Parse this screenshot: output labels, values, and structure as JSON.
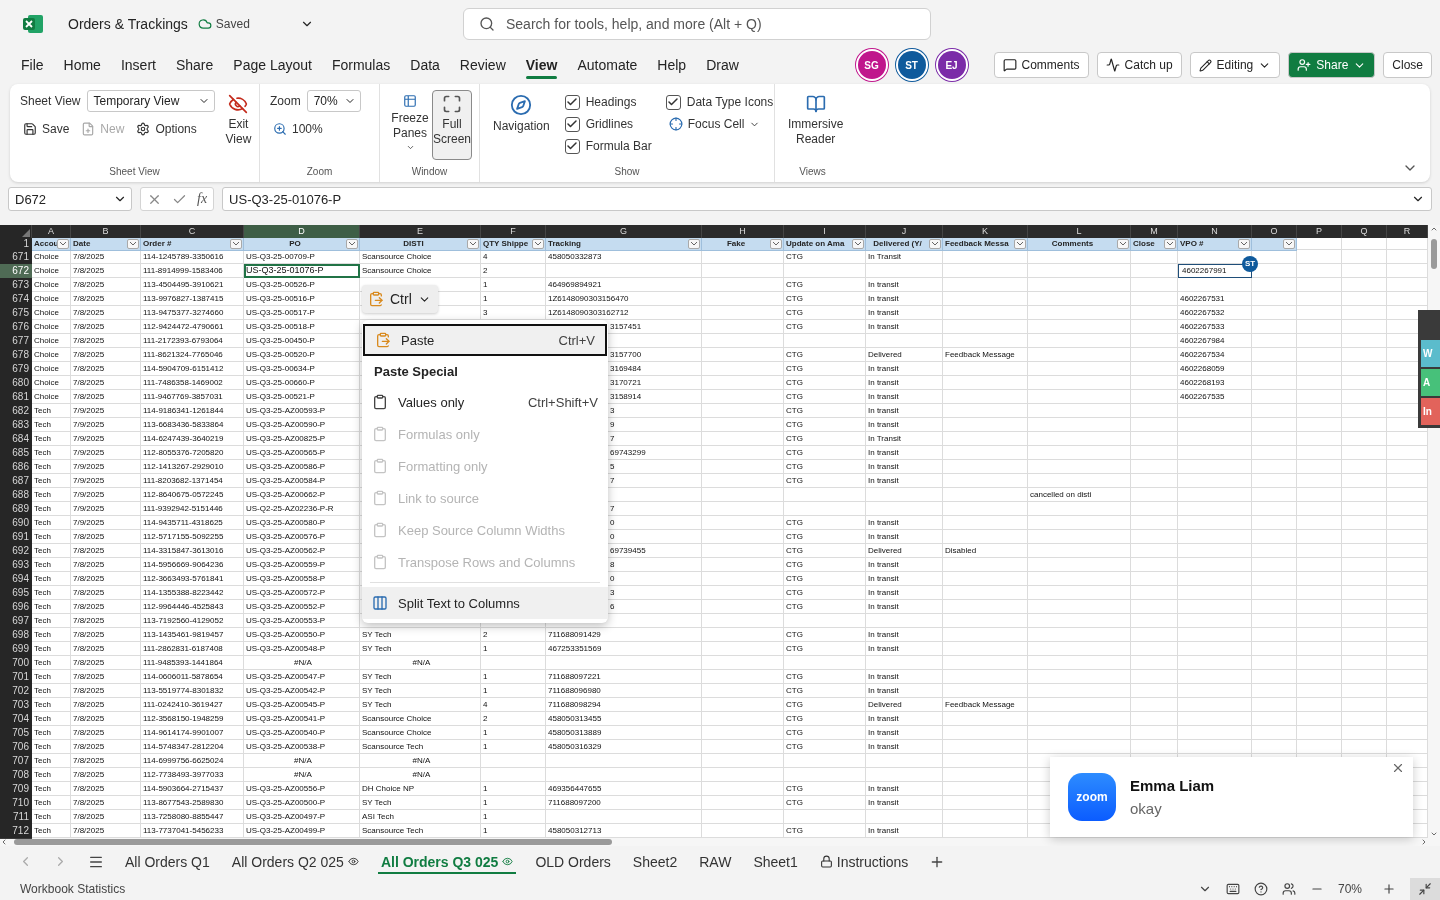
{
  "title_bar": {
    "document_title": "Orders & Trackings",
    "save_status": "Saved",
    "search_placeholder": "Search for tools, help, and more (Alt + Q)"
  },
  "menu_tabs": [
    {
      "label": "File",
      "selected": false
    },
    {
      "label": "Home",
      "selected": false
    },
    {
      "label": "Insert",
      "selected": false
    },
    {
      "label": "Share",
      "selected": false
    },
    {
      "label": "Page Layout",
      "selected": false
    },
    {
      "label": "Formulas",
      "selected": false
    },
    {
      "label": "Data",
      "selected": false
    },
    {
      "label": "Review",
      "selected": false
    },
    {
      "label": "View",
      "selected": true
    },
    {
      "label": "Automate",
      "selected": false
    },
    {
      "label": "Help",
      "selected": false
    },
    {
      "label": "Draw",
      "selected": false
    }
  ],
  "collaborators": [
    {
      "initials": "SG",
      "color": "#c0168c"
    },
    {
      "initials": "ST",
      "color": "#0f5a9c"
    },
    {
      "initials": "EJ",
      "color": "#7b2ba8"
    }
  ],
  "actions": [
    {
      "label": "Comments",
      "kind": "comments"
    },
    {
      "label": "Catch up",
      "kind": "catchup"
    },
    {
      "label": "Editing",
      "kind": "editing"
    },
    {
      "label": "Share",
      "kind": "share"
    },
    {
      "label": "Close",
      "kind": "close"
    }
  ],
  "ribbon": {
    "sheet_view": {
      "label": "Sheet View",
      "view": "Temporary View",
      "exit": "Exit View",
      "save": "Save",
      "new": {
        "label": "New",
        "disabled": true
      },
      "options": "Options",
      "group": "Sheet View"
    },
    "zoom": {
      "label": "Zoom",
      "value": "70%",
      "reset": "100%",
      "group": "Zoom"
    },
    "window": {
      "freeze": "Freeze Panes",
      "full_screen": {
        "label": "Full Screen",
        "selected": true
      },
      "group": "Window"
    },
    "show": {
      "navigation": "Navigation",
      "options": [
        {
          "label": "Headings",
          "checked": true
        },
        {
          "label": "Gridlines",
          "checked": true
        },
        {
          "label": "Formula Bar",
          "checked": true
        },
        {
          "label": "Data Type Icons",
          "checked": true
        }
      ],
      "focus_cell": "Focus Cell",
      "group": "Show"
    },
    "views": {
      "immersive": "Immersive Reader",
      "group": "Views"
    }
  },
  "formula_bar": {
    "name_box": "D672",
    "function_label": "fx",
    "formula": "US-Q3-25-01076-P"
  },
  "sheet": {
    "header_row_number": "1",
    "columns": [
      {
        "letter": "A",
        "header": "Accou",
        "filter": true,
        "selected": false
      },
      {
        "letter": "B",
        "header": "Date",
        "filter": true,
        "selected": false
      },
      {
        "letter": "C",
        "header": "Order #",
        "filter": true,
        "selected": false
      },
      {
        "letter": "D",
        "header": "PO",
        "filter": true,
        "selected": true
      },
      {
        "letter": "E",
        "header": "DISTI",
        "filter": true,
        "selected": false
      },
      {
        "letter": "F",
        "header": "QTY Shippe",
        "filter": true,
        "selected": false
      },
      {
        "letter": "G",
        "header": "Tracking",
        "filter": true,
        "selected": false
      },
      {
        "letter": "H",
        "header": "Fake",
        "filter": true,
        "selected": false
      },
      {
        "letter": "I",
        "header": "Update on Ama",
        "filter": true,
        "selected": false
      },
      {
        "letter": "J",
        "header": "Delivered (Y/",
        "filter": true,
        "selected": false
      },
      {
        "letter": "K",
        "header": "Feedback Messa",
        "filter": true,
        "selected": false
      },
      {
        "letter": "L",
        "header": "Comments",
        "filter": true,
        "selected": false
      },
      {
        "letter": "M",
        "header": "Close",
        "filter": true,
        "selected": false
      },
      {
        "letter": "N",
        "header": "VPO #",
        "filter": true,
        "selected": false
      },
      {
        "letter": "O",
        "filter": true,
        "selected": false
      },
      {
        "letter": "P",
        "filter": false,
        "selected": false
      },
      {
        "letter": "Q",
        "filter": false,
        "selected": false
      },
      {
        "letter": "R",
        "filter": false,
        "selected": false
      }
    ],
    "rows": [
      {
        "n": "671",
        "selected": false,
        "cells": {
          "A": "Choice",
          "B": "7/8/2025",
          "C": "114-1245789-3350616",
          "D": "US-Q3-25-00709-P",
          "E": "Scansource Choice",
          "F": "4",
          "G": "458050332873",
          "I": "CTG",
          "J": "In Transit"
        }
      },
      {
        "n": "672",
        "selected": true,
        "cells": {
          "A": "Choice",
          "B": "7/8/2025",
          "C": "111-8914999-1583406",
          "D": "US-Q3-25-01076-P",
          "E": "Scansource Choice",
          "F": "2",
          "N": {
            "text": "4602267991",
            "presence": "ST"
          }
        }
      },
      {
        "n": "673",
        "selected": false,
        "cells": {
          "A": "Choice",
          "B": "7/8/2025",
          "C": "113-4504495-3910621",
          "D": "US-Q3-25-00526-P",
          "F": "1",
          "G": "464969894921",
          "I": "CTG",
          "J": "In transit"
        }
      },
      {
        "n": "674",
        "selected": false,
        "cells": {
          "A": "Choice",
          "B": "7/8/2025",
          "C": "113-9976827-1387415",
          "D": "US-Q3-25-00516-P",
          "F": "1",
          "G": "1Z6148090303156470",
          "I": "CTG",
          "J": "In transit",
          "N": "4602267531"
        }
      },
      {
        "n": "675",
        "selected": false,
        "cells": {
          "A": "Choice",
          "B": "7/8/2025",
          "C": "113-9475377-3274660",
          "D": "US-Q3-25-00517-P",
          "F": "3",
          "G": "1Z6148090303162712",
          "I": "CTG",
          "J": "In transit",
          "N": "4602267532"
        }
      },
      {
        "n": "676",
        "selected": false,
        "cells": {
          "A": "Choice",
          "B": "7/8/2025",
          "C": "112-9424472-4790661",
          "D": "US-Q3-25-00518-P",
          "G": {
            "text": "3157451",
            "kind": "partial"
          },
          "I": "CTG",
          "J": "In transit",
          "N": "4602267533"
        }
      },
      {
        "n": "677",
        "selected": false,
        "cells": {
          "A": "Choice",
          "B": "7/8/2025",
          "C": "111-2172393-6793064",
          "D": "US-Q3-25-00450-P",
          "N": "4602267984"
        }
      },
      {
        "n": "678",
        "selected": false,
        "cells": {
          "A": "Choice",
          "B": "7/8/2025",
          "C": "111-8621324-7765046",
          "D": "US-Q3-25-00520-P",
          "G": {
            "text": "3157700",
            "kind": "partial"
          },
          "I": "CTG",
          "J": "Delivered",
          "K": "Feedback Message",
          "N": "4602267534"
        }
      },
      {
        "n": "679",
        "selected": false,
        "cells": {
          "A": "Choice",
          "B": "7/8/2025",
          "C": "114-5904709-6151412",
          "D": "US-Q3-25-00634-P",
          "G": {
            "text": "3169484",
            "kind": "partial"
          },
          "I": "CTG",
          "J": "In transit",
          "N": "4602268059"
        }
      },
      {
        "n": "680",
        "selected": false,
        "cells": {
          "A": "Choice",
          "B": "7/8/2025",
          "C": "111-7486358-1469002",
          "D": "US-Q3-25-00660-P",
          "G": {
            "text": "3170721",
            "kind": "partial"
          },
          "I": "CTG",
          "J": "In transit",
          "N": "4602268193"
        }
      },
      {
        "n": "681",
        "selected": false,
        "cells": {
          "A": "Choice",
          "B": "7/8/2025",
          "C": "111-9467769-3857031",
          "D": "US-Q3-25-00521-P",
          "G": {
            "text": "3158914",
            "kind": "partial"
          },
          "I": "CTG",
          "J": "In transit",
          "N": "4602267535"
        }
      },
      {
        "n": "682",
        "selected": false,
        "cells": {
          "A": "Tech",
          "B": "7/9/2025",
          "C": "114-9186341-1261844",
          "D": "US-Q3-25-AZ00593-P",
          "G": {
            "text": "3",
            "kind": "partial"
          },
          "I": "CTG",
          "J": "In transit"
        }
      },
      {
        "n": "683",
        "selected": false,
        "cells": {
          "A": "Tech",
          "B": "7/9/2025",
          "C": "113-6683436-5833864",
          "D": "US-Q3-25-AZ00590-P",
          "G": {
            "text": "9",
            "kind": "partial"
          },
          "I": "CTG",
          "J": "In transit"
        }
      },
      {
        "n": "684",
        "selected": false,
        "cells": {
          "A": "Tech",
          "B": "7/9/2025",
          "C": "114-6247439-3640219",
          "D": "US-Q3-25-AZ00825-P",
          "G": {
            "text": "7",
            "kind": "partial"
          },
          "I": "CTG",
          "J": "In Transit"
        }
      },
      {
        "n": "685",
        "selected": false,
        "cells": {
          "A": "Tech",
          "B": "7/9/2025",
          "C": "112-8055376-7205820",
          "D": "US-Q3-25-AZ00565-P",
          "G": {
            "text": "69743299",
            "kind": "partial"
          },
          "I": "CTG",
          "J": "In transit"
        }
      },
      {
        "n": "686",
        "selected": false,
        "cells": {
          "A": "Tech",
          "B": "7/9/2025",
          "C": "112-1413267-2929010",
          "D": "US-Q3-25-AZ00586-P",
          "G": {
            "text": "5",
            "kind": "partial"
          },
          "I": "CTG",
          "J": "In transit"
        }
      },
      {
        "n": "687",
        "selected": false,
        "cells": {
          "A": "Tech",
          "B": "7/9/2025",
          "C": "111-8203682-1371454",
          "D": "US-Q3-25-AZ00584-P",
          "G": {
            "text": "7",
            "kind": "partial"
          },
          "I": "CTG",
          "J": "In transit"
        }
      },
      {
        "n": "688",
        "selected": false,
        "cells": {
          "A": "Tech",
          "B": "7/9/2025",
          "C": "112-8640675-0572245",
          "D": "US-Q3-25-AZ00662-P",
          "L": "cancelled on disti"
        }
      },
      {
        "n": "689",
        "selected": false,
        "cells": {
          "A": "Tech",
          "B": "7/9/2025",
          "C": "111-9392942-5151446",
          "D": "US-Q2-25-AZ02236-P-R",
          "G": {
            "text": "7",
            "kind": "partial"
          }
        }
      },
      {
        "n": "690",
        "selected": false,
        "cells": {
          "A": "Tech",
          "B": "7/9/2025",
          "C": "114-9435711-4318625",
          "D": "US-Q3-25-AZ00580-P",
          "G": {
            "text": "0",
            "kind": "partial"
          },
          "I": "CTG",
          "J": "In transit"
        }
      },
      {
        "n": "691",
        "selected": false,
        "cells": {
          "A": "Tech",
          "B": "7/8/2025",
          "C": "112-5717155-5092255",
          "D": "US-Q3-25-AZ00576-P",
          "G": {
            "text": "0",
            "kind": "partial"
          },
          "I": "CTG",
          "J": "In transit"
        }
      },
      {
        "n": "692",
        "selected": false,
        "cells": {
          "A": "Tech",
          "B": "7/8/2025",
          "C": "114-3315847-3613016",
          "D": "US-Q3-25-AZ00562-P",
          "G": {
            "text": "69739455",
            "kind": "partial"
          },
          "I": "CTG",
          "J": "Delivered",
          "K": "Disabled"
        }
      },
      {
        "n": "693",
        "selected": false,
        "cells": {
          "A": "Tech",
          "B": "7/8/2025",
          "C": "114-5956669-9064236",
          "D": "US-Q3-25-AZ00559-P",
          "G": {
            "text": "8",
            "kind": "partial"
          },
          "I": "CTG",
          "J": "In transit"
        }
      },
      {
        "n": "694",
        "selected": false,
        "cells": {
          "A": "Tech",
          "B": "7/8/2025",
          "C": "112-3663493-5761841",
          "D": "US-Q3-25-AZ00558-P",
          "G": {
            "text": "0",
            "kind": "partial"
          },
          "I": "CTG",
          "J": "In transit"
        }
      },
      {
        "n": "695",
        "selected": false,
        "cells": {
          "A": "Tech",
          "B": "7/8/2025",
          "C": "114-1355388-8223442",
          "D": "US-Q3-25-AZ00572-P",
          "G": {
            "text": "3",
            "kind": "partial"
          },
          "I": "CTG",
          "J": "In transit"
        }
      },
      {
        "n": "696",
        "selected": false,
        "cells": {
          "A": "Tech",
          "B": "7/8/2025",
          "C": "112-9964446-4525843",
          "D": "US-Q3-25-AZ00552-P",
          "G": {
            "text": "6",
            "kind": "partial"
          },
          "I": "CTG",
          "J": "In transit"
        }
      },
      {
        "n": "697",
        "selected": false,
        "cells": {
          "A": "Tech",
          "B": "7/8/2025",
          "C": "113-7192560-4129052",
          "D": "US-Q3-25-AZ00553-P"
        }
      },
      {
        "n": "698",
        "selected": false,
        "cells": {
          "A": "Tech",
          "B": "7/8/2025",
          "C": "113-1435461-9819457",
          "D": "US-Q3-25-AZ00550-P",
          "E": "SY Tech",
          "F": "2",
          "G": "711688091429",
          "I": "CTG",
          "J": "In transit"
        }
      },
      {
        "n": "699",
        "selected": false,
        "cells": {
          "A": "Tech",
          "B": "7/8/2025",
          "C": "111-2862831-6187408",
          "D": "US-Q3-25-AZ00548-P",
          "E": "SY Tech",
          "F": "1",
          "G": "467253351569",
          "I": "CTG",
          "J": "In transit"
        }
      },
      {
        "n": "700",
        "selected": false,
        "cells": {
          "A": "Tech",
          "B": "7/8/2025",
          "C": "111-9485393-1441864",
          "D": {
            "text": "#N/A",
            "kind": "error"
          },
          "E": {
            "text": "#N/A",
            "kind": "error"
          }
        }
      },
      {
        "n": "701",
        "selected": false,
        "cells": {
          "A": "Tech",
          "B": "7/8/2025",
          "C": "114-0606011-5878654",
          "D": "US-Q3-25-AZ00547-P",
          "E": "SY Tech",
          "F": "1",
          "G": "711688097221",
          "I": "CTG",
          "J": "In transit"
        }
      },
      {
        "n": "702",
        "selected": false,
        "cells": {
          "A": "Tech",
          "B": "7/8/2025",
          "C": "113-5519774-8301832",
          "D": "US-Q3-25-AZ00542-P",
          "E": "SY Tech",
          "F": "1",
          "G": "711688096980",
          "I": "CTG",
          "J": "In transit"
        }
      },
      {
        "n": "703",
        "selected": false,
        "cells": {
          "A": "Tech",
          "B": "7/8/2025",
          "C": "111-0242410-3619427",
          "D": "US-Q3-25-AZ00545-P",
          "E": "SY Tech",
          "F": "4",
          "G": "711688098294",
          "I": "CTG",
          "J": "Delivered",
          "K": "Feedback Message"
        }
      },
      {
        "n": "704",
        "selected": false,
        "cells": {
          "A": "Tech",
          "B": "7/8/2025",
          "C": "112-3568150-1948259",
          "D": "US-Q3-25-AZ00541-P",
          "E": "Scansource Choice",
          "F": "2",
          "G": "458050313455",
          "I": "CTG",
          "J": "In transit"
        }
      },
      {
        "n": "705",
        "selected": false,
        "cells": {
          "A": "Tech",
          "B": "7/8/2025",
          "C": "114-9614174-9901007",
          "D": "US-Q3-25-AZ00540-P",
          "E": "Scansource Choice",
          "F": "1",
          "G": "458050313889",
          "I": "CTG",
          "J": "In transit"
        }
      },
      {
        "n": "706",
        "selected": false,
        "cells": {
          "A": "Tech",
          "B": "7/8/2025",
          "C": "114-5748347-2812204",
          "D": "US-Q3-25-AZ00538-P",
          "E": "Scansource Tech",
          "F": "1",
          "G": "458050316329",
          "I": "CTG",
          "J": "In transit"
        }
      },
      {
        "n": "707",
        "selected": false,
        "cells": {
          "A": "Tech",
          "B": "7/8/2025",
          "C": "114-6999756-6625024",
          "D": {
            "text": "#N/A",
            "kind": "error"
          },
          "E": {
            "text": "#N/A",
            "kind": "error"
          }
        }
      },
      {
        "n": "708",
        "selected": false,
        "cells": {
          "A": "Tech",
          "B": "7/8/2025",
          "C": "112-7738493-3977033",
          "D": {
            "text": "#N/A",
            "kind": "error"
          },
          "E": {
            "text": "#N/A",
            "kind": "error"
          }
        }
      },
      {
        "n": "709",
        "selected": false,
        "cells": {
          "A": "Tech",
          "B": "7/8/2025",
          "C": "114-5903664-2715437",
          "D": "US-Q3-25-AZ00556-P",
          "E": "DH Choice NP",
          "F": "1",
          "G": "469356447655",
          "I": "CTG",
          "J": "In transit"
        }
      },
      {
        "n": "710",
        "selected": false,
        "cells": {
          "A": "Tech",
          "B": "7/8/2025",
          "C": "113-8677543-2589830",
          "D": "US-Q3-25-AZ00500-P",
          "E": "SY Tech",
          "F": "1",
          "G": "711688097200",
          "I": "CTG",
          "J": "In transit"
        }
      },
      {
        "n": "711",
        "selected": false,
        "cells": {
          "A": "Tech",
          "B": "7/8/2025",
          "C": "113-7258080-8855447",
          "D": "US-Q3-25-AZ00497-P",
          "E": "ASI Tech",
          "F": "1"
        }
      },
      {
        "n": "712",
        "selected": false,
        "cells": {
          "A": "Tech",
          "B": "7/8/2025",
          "C": "113-7737041-5456233",
          "D": "US-Q3-25-AZ00499-P",
          "E": "Scansource Tech",
          "F": "1",
          "G": "458050312713",
          "I": "CTG",
          "J": "In transit"
        }
      }
    ]
  },
  "context_menu": {
    "trigger": "Ctrl",
    "items": [
      {
        "kind": "paste",
        "label": "Paste",
        "shortcut": "Ctrl+V",
        "selected": true,
        "hovered": false,
        "disabled": false
      },
      {
        "kind": "heading",
        "label": "Paste Special"
      },
      {
        "kind": "values",
        "label": "Values only",
        "shortcut": "Ctrl+Shift+V",
        "selected": false,
        "hovered": false,
        "disabled": false
      },
      {
        "kind": "formulas",
        "label": "Formulas only",
        "selected": false,
        "hovered": false,
        "disabled": true
      },
      {
        "kind": "formatting",
        "label": "Formatting only",
        "selected": false,
        "hovered": false,
        "disabled": true
      },
      {
        "kind": "link",
        "label": "Link to source",
        "selected": false,
        "hovered": false,
        "disabled": true
      },
      {
        "kind": "widths",
        "label": "Keep Source Column Widths",
        "selected": false,
        "hovered": false,
        "disabled": true
      },
      {
        "kind": "transpose",
        "label": "Transpose Rows and Columns",
        "selected": false,
        "hovered": false,
        "disabled": true
      },
      {
        "kind": "separator"
      },
      {
        "kind": "split",
        "label": "Split Text to Columns",
        "selected": false,
        "hovered": true,
        "disabled": false
      }
    ]
  },
  "side_tabs": [
    {
      "label": "W",
      "color": "#5bbccc"
    },
    {
      "label": "A",
      "color": "#47c17a"
    },
    {
      "label": "In",
      "color": "#e2635b"
    }
  ],
  "notification": {
    "logo_text": "zoom",
    "sender": "Emma Liam",
    "message": "okay"
  },
  "sheet_tabs": [
    {
      "label": "All Orders Q1",
      "kind": "plain",
      "selected": false
    },
    {
      "label": "All Orders Q2 025",
      "kind": "view",
      "selected": false
    },
    {
      "label": "All Orders Q3 025",
      "kind": "view",
      "selected": true
    },
    {
      "label": "OLD Orders",
      "kind": "plain",
      "selected": false
    },
    {
      "label": "Sheet2",
      "kind": "plain",
      "selected": false
    },
    {
      "label": "RAW",
      "kind": "plain",
      "selected": false
    },
    {
      "label": "Sheet1",
      "kind": "plain",
      "selected": false
    },
    {
      "label": "Instructions",
      "kind": "locked",
      "selected": false
    }
  ],
  "status_bar": {
    "label": "Workbook Statistics",
    "zoom": "70%"
  }
}
